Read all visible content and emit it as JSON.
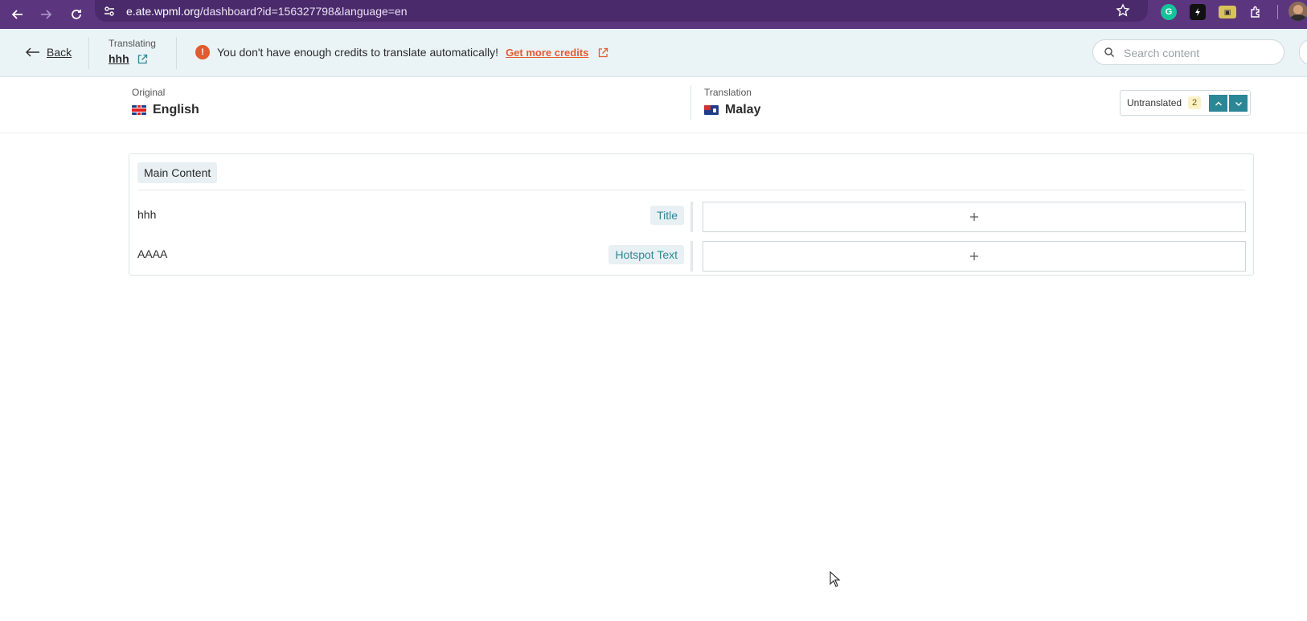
{
  "browser": {
    "url_host": "e.ate.wpml.org",
    "url_path": "/dashboard?id=156327798&language=en"
  },
  "header": {
    "back_label": "Back",
    "translating_caption": "Translating",
    "document_name": "hhh",
    "credits_warning_icon": "!",
    "credits_warning": "You don't have enough credits to translate automatically!",
    "credits_link": "Get more credits",
    "search_placeholder": "Search content"
  },
  "languages": {
    "original_caption": "Original",
    "original_language": "English",
    "translation_caption": "Translation",
    "translation_language": "Malay",
    "filter_label": "Untranslated",
    "filter_count": "2"
  },
  "content": {
    "section_label": "Main Content",
    "rows": [
      {
        "source": "hhh",
        "field": "Title"
      },
      {
        "source": "AAAA",
        "field": "Hotspot Text"
      }
    ]
  },
  "colors": {
    "chrome": "#5b357e",
    "header_bg": "#eaf3f6",
    "accent": "#2b8796",
    "warning": "#e25b2e"
  }
}
